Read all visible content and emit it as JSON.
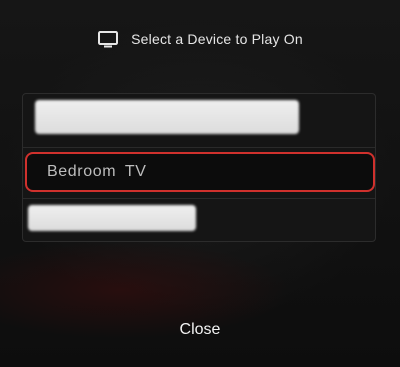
{
  "header": {
    "icon": "tv-icon",
    "title": "Select a Device to Play On"
  },
  "devices": [
    {
      "label": "",
      "redacted": true,
      "selected": false
    },
    {
      "label": "Bedroom  TV",
      "redacted": false,
      "selected": true
    },
    {
      "label": "",
      "redacted": true,
      "selected": false
    }
  ],
  "footer": {
    "close_label": "Close"
  },
  "colors": {
    "selected_border": "#d0312d",
    "background": "#121212",
    "text": "#e6e6e6"
  }
}
